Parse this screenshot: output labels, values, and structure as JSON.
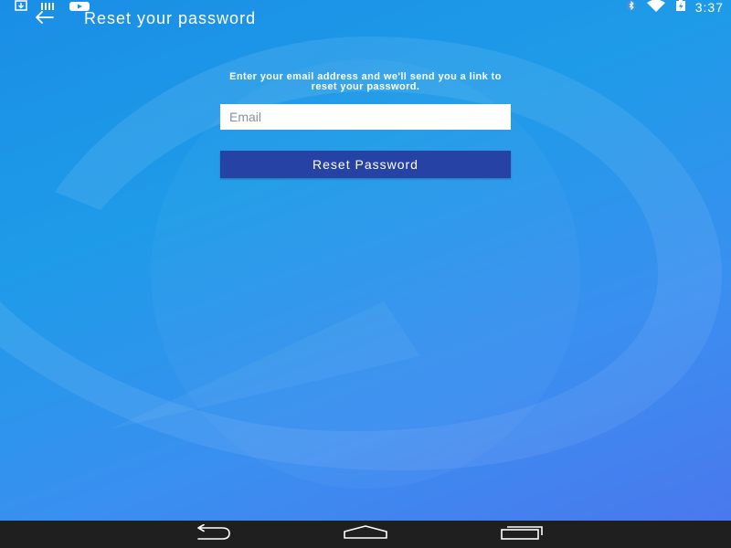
{
  "status_bar": {
    "time": "3:37",
    "left_icons": [
      "download-icon",
      "barcode-icon",
      "youtube-icon"
    ],
    "right_icons": [
      "bluetooth-icon",
      "wifi-icon",
      "battery-charging-icon"
    ]
  },
  "app_bar": {
    "title": "Reset your password",
    "back_icon": "arrow-left-icon"
  },
  "form": {
    "instructions": "Enter your email address and we'll send you a link to reset your password.",
    "email_placeholder": "Email",
    "email_value": "",
    "submit_label": "Reset Password"
  },
  "nav_bar": {
    "buttons": [
      "back-icon",
      "home-icon",
      "recents-icon"
    ]
  },
  "colors": {
    "background_start": "#1a8ee6",
    "background_end": "#4a78ee",
    "button": "#2642a5",
    "nav_bar": "#1f1f1f"
  }
}
